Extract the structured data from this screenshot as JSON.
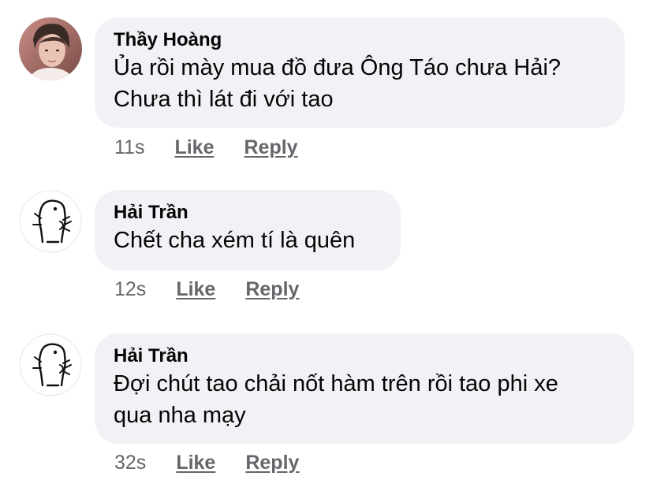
{
  "comments": [
    {
      "author": "Thầy Hoàng",
      "avatar": "photo-avatar",
      "line1": "Ủa rồi mày mua đồ đưa Ông Táo chưa Hải?",
      "line2": "Chưa thì lát đi với tao",
      "time": "11s",
      "like": "Like",
      "reply": "Reply"
    },
    {
      "author": "Hải Trần",
      "avatar": "doodle-avatar",
      "line1": "Chết cha xém tí là quên",
      "line2": "",
      "time": "12s",
      "like": "Like",
      "reply": "Reply"
    },
    {
      "author": "Hải Trần",
      "avatar": "doodle-avatar",
      "line1": "Đợi chút tao chải nốt hàm trên rồi tao phi xe",
      "line2": "qua nha mạy",
      "time": "32s",
      "like": "Like",
      "reply": "Reply"
    }
  ],
  "colors": {
    "bubble": "#f0f2f5",
    "text": "#050505",
    "meta": "#65676b"
  }
}
